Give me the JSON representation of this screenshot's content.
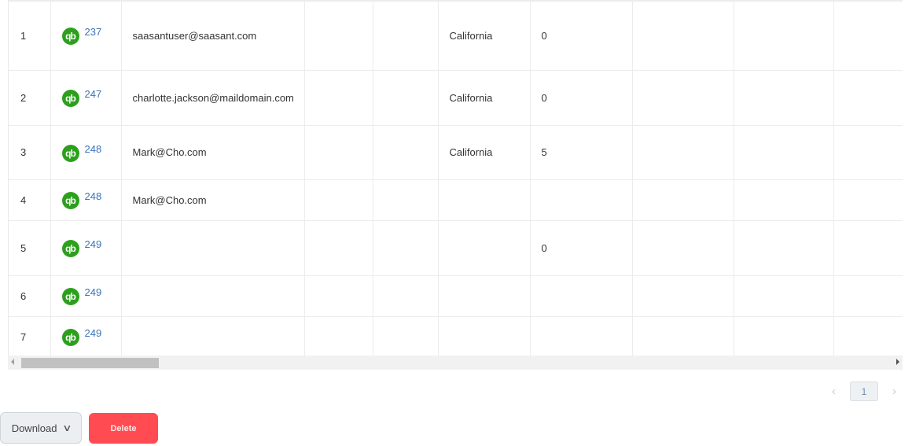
{
  "table": {
    "rows": [
      {
        "index": "1",
        "id": "237",
        "email": "saasantuser@saasant.com",
        "col4": "",
        "col5": "",
        "state": "California",
        "qty": "0"
      },
      {
        "index": "2",
        "id": "247",
        "email": "charlotte.jackson@maildomain.com",
        "col4": "",
        "col5": "",
        "state": "California",
        "qty": "0"
      },
      {
        "index": "3",
        "id": "248",
        "email": "Mark@Cho.com",
        "col4": "",
        "col5": "",
        "state": "California",
        "qty": "5"
      },
      {
        "index": "4",
        "id": "248",
        "email": "Mark@Cho.com",
        "col4": "",
        "col5": "",
        "state": "",
        "qty": ""
      },
      {
        "index": "5",
        "id": "249",
        "email": "",
        "col4": "",
        "col5": "",
        "state": "",
        "qty": "0"
      },
      {
        "index": "6",
        "id": "249",
        "email": "",
        "col4": "",
        "col5": "",
        "state": "",
        "qty": ""
      },
      {
        "index": "7",
        "id": "249",
        "email": "",
        "col4": "",
        "col5": "",
        "state": "",
        "qty": ""
      }
    ],
    "row_icon": "quickbooks-logo-icon",
    "row_icon_text": "qb"
  },
  "pagination": {
    "prev_icon": "‹",
    "current_page": "1",
    "next_icon": "›"
  },
  "actions": {
    "download_label": "Download",
    "download_chevron": "∨",
    "delete_label": "Delete"
  },
  "colors": {
    "qb_green": "#2ca01c",
    "link_blue": "#3b73b9",
    "delete_red": "#ff4b51"
  }
}
